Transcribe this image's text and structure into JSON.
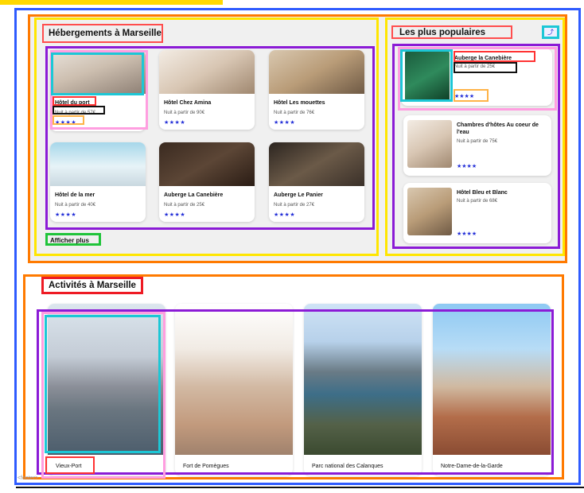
{
  "hebergements": {
    "title": "Hébergements à Marseille",
    "show_more": "Afficher plus",
    "cards": [
      {
        "name": "Hôtel du port",
        "price": "Nuit à partir de 57€",
        "stars": "★★★★"
      },
      {
        "name": "Hôtel Chez Amina",
        "price": "Nuit à partir de 90€",
        "stars": "★★★★"
      },
      {
        "name": "Hôtel Les mouettes",
        "price": "Nuit à partir de 76€",
        "stars": "★★★★"
      },
      {
        "name": "Hôtel de la mer",
        "price": "Nuit à partir de 40€",
        "stars": "★★★★"
      },
      {
        "name": "Auberge La Canebière",
        "price": "Nuit à partir de 25€",
        "stars": "★★★★"
      },
      {
        "name": "Auberge Le Panier",
        "price": "Nuit à partir de 27€",
        "stars": "★★★★"
      }
    ]
  },
  "populaires": {
    "title": "Les plus populaires",
    "icon": "trend-icon",
    "cards": [
      {
        "name": "Auberge la Canebière",
        "price": "Nuit à partir de 25€",
        "stars": "★★★★"
      },
      {
        "name": "Chambres d'hôtes Au coeur de l'eau",
        "price": "Nuit à partir de 75€",
        "stars": "★★★★"
      },
      {
        "name": "Hôtel Bleu et Blanc",
        "price": "Nuit à partir de 68€",
        "stars": "★★★★"
      }
    ]
  },
  "activites": {
    "title": "Activités à Marseille",
    "cards": [
      {
        "label": "Vieux-Port"
      },
      {
        "label": "Fort de Pomègues"
      },
      {
        "label": "Parc national des Calanques"
      },
      {
        "label": "Notre-Dame-de-la-Garde"
      }
    ]
  },
  "footer": {
    "text": "<footer>"
  },
  "colors": {
    "star": "#2430d8",
    "accent_orange": "#ff7a00",
    "accent_purple": "#8b1bd6",
    "accent_blue": "#2e5bff"
  }
}
